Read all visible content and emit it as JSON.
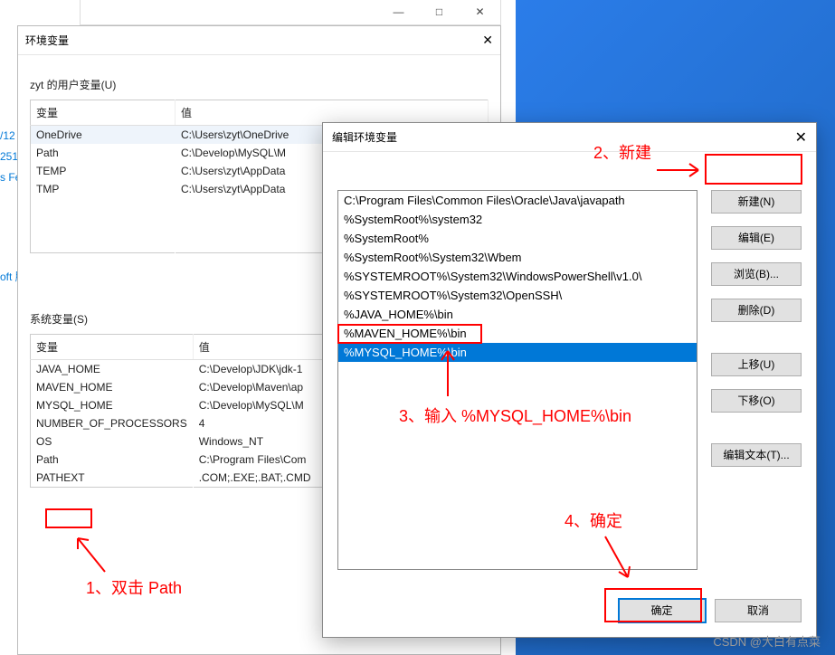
{
  "desktop": {},
  "left_hints": [
    "/12",
    "251",
    "s Fe…",
    " ",
    "oft 服"
  ],
  "parent_window": {
    "minimize": "—",
    "maximize": "□",
    "close": "✕"
  },
  "env_dialog": {
    "title": "环境变量",
    "close": "✕",
    "user_section": "zyt 的用户变量(U)",
    "user_headers": {
      "var": "变量",
      "val": "值"
    },
    "user_rows": [
      {
        "var": "OneDrive",
        "val": "C:\\Users\\zyt\\OneDrive"
      },
      {
        "var": "Path",
        "val": "C:\\Develop\\MySQL\\M"
      },
      {
        "var": "TEMP",
        "val": "C:\\Users\\zyt\\AppData"
      },
      {
        "var": "TMP",
        "val": "C:\\Users\\zyt\\AppData"
      }
    ],
    "sys_section": "系统变量(S)",
    "sys_headers": {
      "var": "变量",
      "val": "值"
    },
    "sys_rows": [
      {
        "var": "JAVA_HOME",
        "val": "C:\\Develop\\JDK\\jdk-1"
      },
      {
        "var": "MAVEN_HOME",
        "val": "C:\\Develop\\Maven\\ap"
      },
      {
        "var": "MYSQL_HOME",
        "val": "C:\\Develop\\MySQL\\M"
      },
      {
        "var": "NUMBER_OF_PROCESSORS",
        "val": "4"
      },
      {
        "var": "OS",
        "val": "Windows_NT"
      },
      {
        "var": "Path",
        "val": "C:\\Program Files\\Com"
      },
      {
        "var": "PATHEXT",
        "val": ".COM;.EXE;.BAT;.CMD"
      }
    ]
  },
  "edit_dialog": {
    "title": "编辑环境变量",
    "close": "✕",
    "rows": [
      "C:\\Program Files\\Common Files\\Oracle\\Java\\javapath",
      "%SystemRoot%\\system32",
      "%SystemRoot%",
      "%SystemRoot%\\System32\\Wbem",
      "%SYSTEMROOT%\\System32\\WindowsPowerShell\\v1.0\\",
      "%SYSTEMROOT%\\System32\\OpenSSH\\",
      "%JAVA_HOME%\\bin",
      "%MAVEN_HOME%\\bin",
      "%MYSQL_HOME%\\bin"
    ],
    "buttons": {
      "new": "新建(N)",
      "edit": "编辑(E)",
      "browse": "浏览(B)...",
      "delete": "删除(D)",
      "up": "上移(U)",
      "down": "下移(O)",
      "edit_text": "编辑文本(T)...",
      "ok": "确定",
      "cancel": "取消"
    }
  },
  "annotations": {
    "a1": "1、双击 Path",
    "a2": "2、新建",
    "a3": "3、输入 %MYSQL_HOME%\\bin",
    "a4": "4、确定"
  },
  "watermark": "CSDN @大白有点菜"
}
